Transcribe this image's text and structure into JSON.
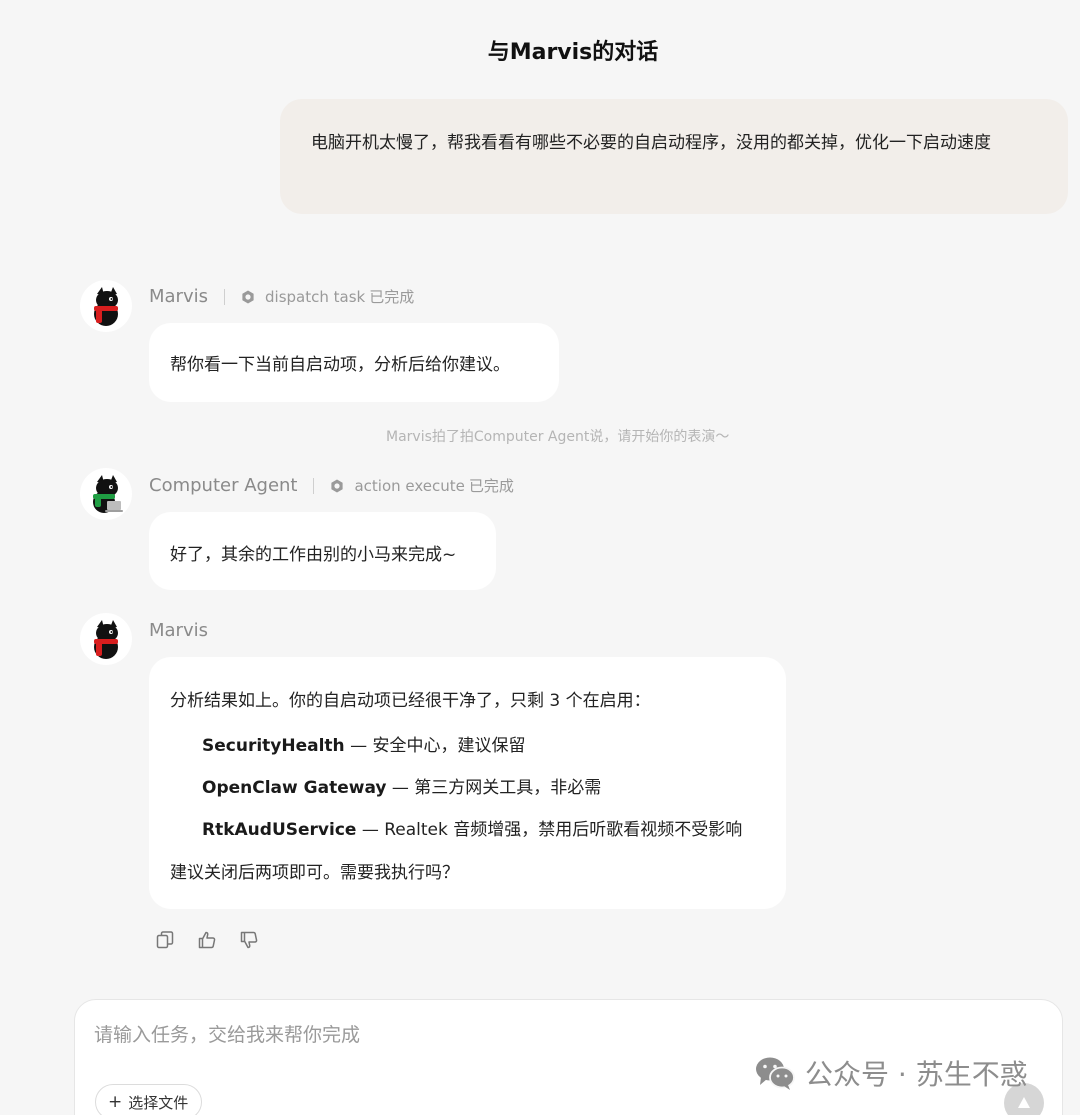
{
  "page": {
    "title": "与Marvis的对话"
  },
  "user_message": {
    "text": "电脑开机太慢了，帮我看看有哪些不必要的自启动程序，没用的都关掉，优化一下启动速度"
  },
  "messages": [
    {
      "sender": "Marvis",
      "status_action": "dispatch task",
      "status_state": "已完成",
      "text": "帮你看一下当前自启动项，分析后给你建议。"
    },
    {
      "system_note": "Marvis拍了拍Computer Agent说，请开始你的表演～"
    },
    {
      "sender": "Computer Agent",
      "status_action": "action execute",
      "status_state": "已完成",
      "text": "好了，其余的工作由别的小马来完成~"
    },
    {
      "sender": "Marvis",
      "intro": "分析结果如上。你的自启动项已经很干净了，只剩 3 个在启用：",
      "items": [
        {
          "name": "SecurityHealth",
          "desc": " — 安全中心，建议保留"
        },
        {
          "name": "OpenClaw Gateway",
          "desc": " — 第三方网关工具，非必需"
        },
        {
          "name": "RtkAudUService",
          "desc": " — Realtek 音频增强，禁用后听歌看视频不受影响"
        }
      ],
      "outro": "建议关闭后两项即可。需要我执行吗？"
    }
  ],
  "actions": {
    "icons": [
      "copy-icon",
      "thumbs-up-icon",
      "thumbs-down-icon"
    ]
  },
  "composer": {
    "placeholder": "请输入任务，交给我来帮你完成",
    "file_button_plus": "+",
    "file_button_label": "选择文件"
  },
  "watermark": {
    "text": "公众号 · 苏生不惑"
  },
  "colors": {
    "background": "#f6f6f6",
    "user_bubble": "#f2eeea",
    "agent_bubble": "#ffffff",
    "scarf_marvis": "#d81e1e",
    "scarf_agent": "#1f9e43"
  }
}
